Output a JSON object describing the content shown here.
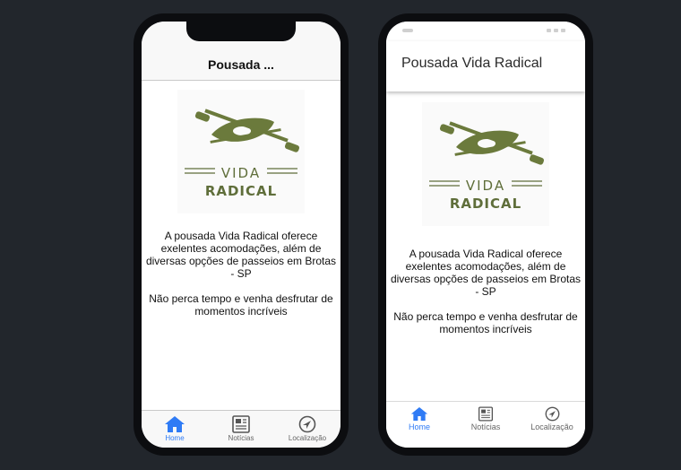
{
  "ios": {
    "title": "Pousada ...",
    "logo": {
      "line1": "VIDA",
      "line2": "RADICAL"
    },
    "paragraph1": "A pousada Vida Radical oferece exelentes acomodações, além de diversas opções de passeios em Brotas - SP",
    "paragraph2": "Não perca tempo e venha desfrutar de momentos incríveis",
    "tabs": [
      {
        "label": "Home",
        "icon": "home-icon",
        "active": true
      },
      {
        "label": "Notícias",
        "icon": "newspaper-icon",
        "active": false
      },
      {
        "label": "Localização",
        "icon": "navigation-icon",
        "active": false
      }
    ]
  },
  "android": {
    "title": "Pousada Vida Radical",
    "logo": {
      "line1": "VIDA",
      "line2": "RADICAL"
    },
    "paragraph1": "A pousada Vida Radical oferece exelentes acomodações, além de diversas opções de passeios em Brotas - SP",
    "paragraph2": "Não perca tempo e venha desfrutar de momentos incríveis",
    "tabs": [
      {
        "label": "Home",
        "icon": "home-icon",
        "active": true
      },
      {
        "label": "Notícias",
        "icon": "newspaper-icon",
        "active": false
      },
      {
        "label": "Localização",
        "icon": "navigation-icon",
        "active": false
      }
    ]
  },
  "colors": {
    "background": "#22262c",
    "accent": "#2f7bf5",
    "logo_green": "#5f6e3a"
  }
}
